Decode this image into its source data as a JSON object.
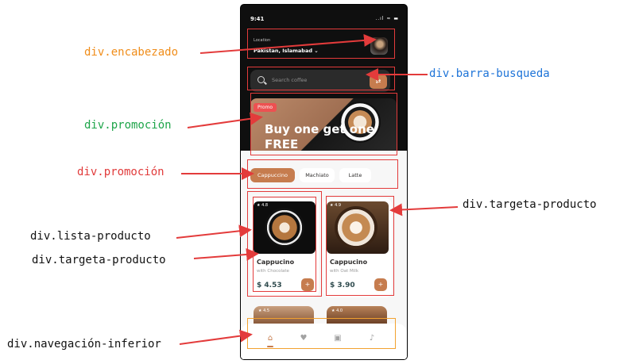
{
  "phone": {
    "status_time": "9:41",
    "status_icons": "..ıl ≈ ▬",
    "location_label": "Location",
    "location_value": "Pakistan, Islamabad ⌄",
    "search_placeholder": "Search coffee",
    "promo_badge": "Promo",
    "promo_title": "Buy one get one FREE",
    "chips": [
      "Cappuccino",
      "Machiato",
      "Latte"
    ],
    "products": [
      {
        "name": "Cappucino",
        "subtitle": "with Chocolate",
        "price": "$ 4.53",
        "rating": "★ 4.8"
      },
      {
        "name": "Cappucino",
        "subtitle": "with Oat Milk",
        "price": "$ 3.90",
        "rating": "★ 4.9"
      }
    ],
    "peek_ratings": [
      "★ 4.5",
      "★ 4.0"
    ],
    "add_symbol": "+",
    "nav_icons": [
      "home-icon",
      "heart-icon",
      "bag-icon",
      "bell-icon"
    ]
  },
  "annotations": [
    {
      "id": "encabezado",
      "label": "div.encabezado",
      "color": "#f08d1a"
    },
    {
      "id": "barra-busqueda",
      "label": "div.barra-busqueda",
      "color": "#1e74d8"
    },
    {
      "id": "promocion-1",
      "label": "div.promoción",
      "color": "#1ea54a"
    },
    {
      "id": "promocion-2",
      "label": "div.promoción",
      "color": "#e13b3b"
    },
    {
      "id": "targeta-producto-right",
      "label": "div.targeta-producto",
      "color": "#111111"
    },
    {
      "id": "lista-producto",
      "label": "div.lista-producto",
      "color": "#111111"
    },
    {
      "id": "targeta-producto-left",
      "label": "div.targeta-producto",
      "color": "#111111"
    },
    {
      "id": "navegacion-inferior",
      "label": "div.navegación-inferior",
      "color": "#111111"
    }
  ],
  "colors": {
    "accent": "#c67c4e",
    "annotation_box": "#e33b3b",
    "annotation_box_nav": "#f2a230",
    "arrow": "#e33b3b"
  }
}
